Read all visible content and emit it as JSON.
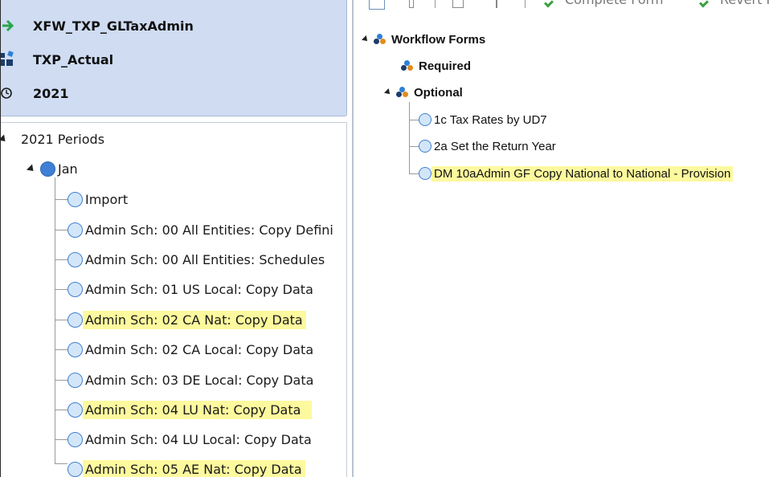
{
  "header": {
    "workflow_name": "XFW_TXP_GLTaxAdmin",
    "scenario": "TXP_Actual",
    "time": "2021"
  },
  "left_tree": {
    "root_label": "2021 Periods",
    "period_label": "Jan",
    "items": [
      {
        "label": "Import",
        "highlighted": false
      },
      {
        "label": "Admin Sch: 00 All Entities: Copy Defini",
        "highlighted": false
      },
      {
        "label": "Admin Sch: 00 All Entities: Schedules",
        "highlighted": false
      },
      {
        "label": "Admin Sch: 01 US Local: Copy Data",
        "highlighted": false
      },
      {
        "label": "Admin Sch: 02 CA Nat: Copy Data",
        "highlighted": true
      },
      {
        "label": "Admin Sch: 02 CA Local: Copy Data",
        "highlighted": false
      },
      {
        "label": "Admin Sch: 03 DE Local: Copy Data",
        "highlighted": false
      },
      {
        "label": "Admin Sch: 04 LU Nat: Copy Data",
        "highlighted": true
      },
      {
        "label": "Admin Sch: 04 LU Local: Copy Data",
        "highlighted": false
      },
      {
        "label": "Admin Sch: 05 AE Nat: Copy Data",
        "highlighted": true
      }
    ]
  },
  "toolbar": {
    "complete_form": "Complete Form",
    "revert_form": "Revert F"
  },
  "right_tree": {
    "root_label": "Workflow Forms",
    "required_label": "Required",
    "optional_label": "Optional",
    "forms": [
      {
        "label": "1c Tax Rates by UD7",
        "highlighted": false
      },
      {
        "label": "2a Set the Return Year",
        "highlighted": false
      },
      {
        "label": "DM 10aAdmin GF Copy National to National - Provision",
        "highlighted": true
      }
    ]
  },
  "colors": {
    "header_bg": "#cfdcf2",
    "highlight": "#fdf99e",
    "node_circle": "#d3e6f9",
    "node_circle_border": "#3f7fd0",
    "arrow_green": "#2aa64a",
    "group_icon_blue": "#2f7fd3",
    "group_icon_orange": "#e58b1e"
  },
  "icons": {
    "workflow": "green-arrow-icon",
    "scenario": "scenario-blocks-icon",
    "time": "clock-icon",
    "group": "workflow-group-icon",
    "node": "circle-status-icon",
    "expand": "expanded-triangle-icon"
  }
}
